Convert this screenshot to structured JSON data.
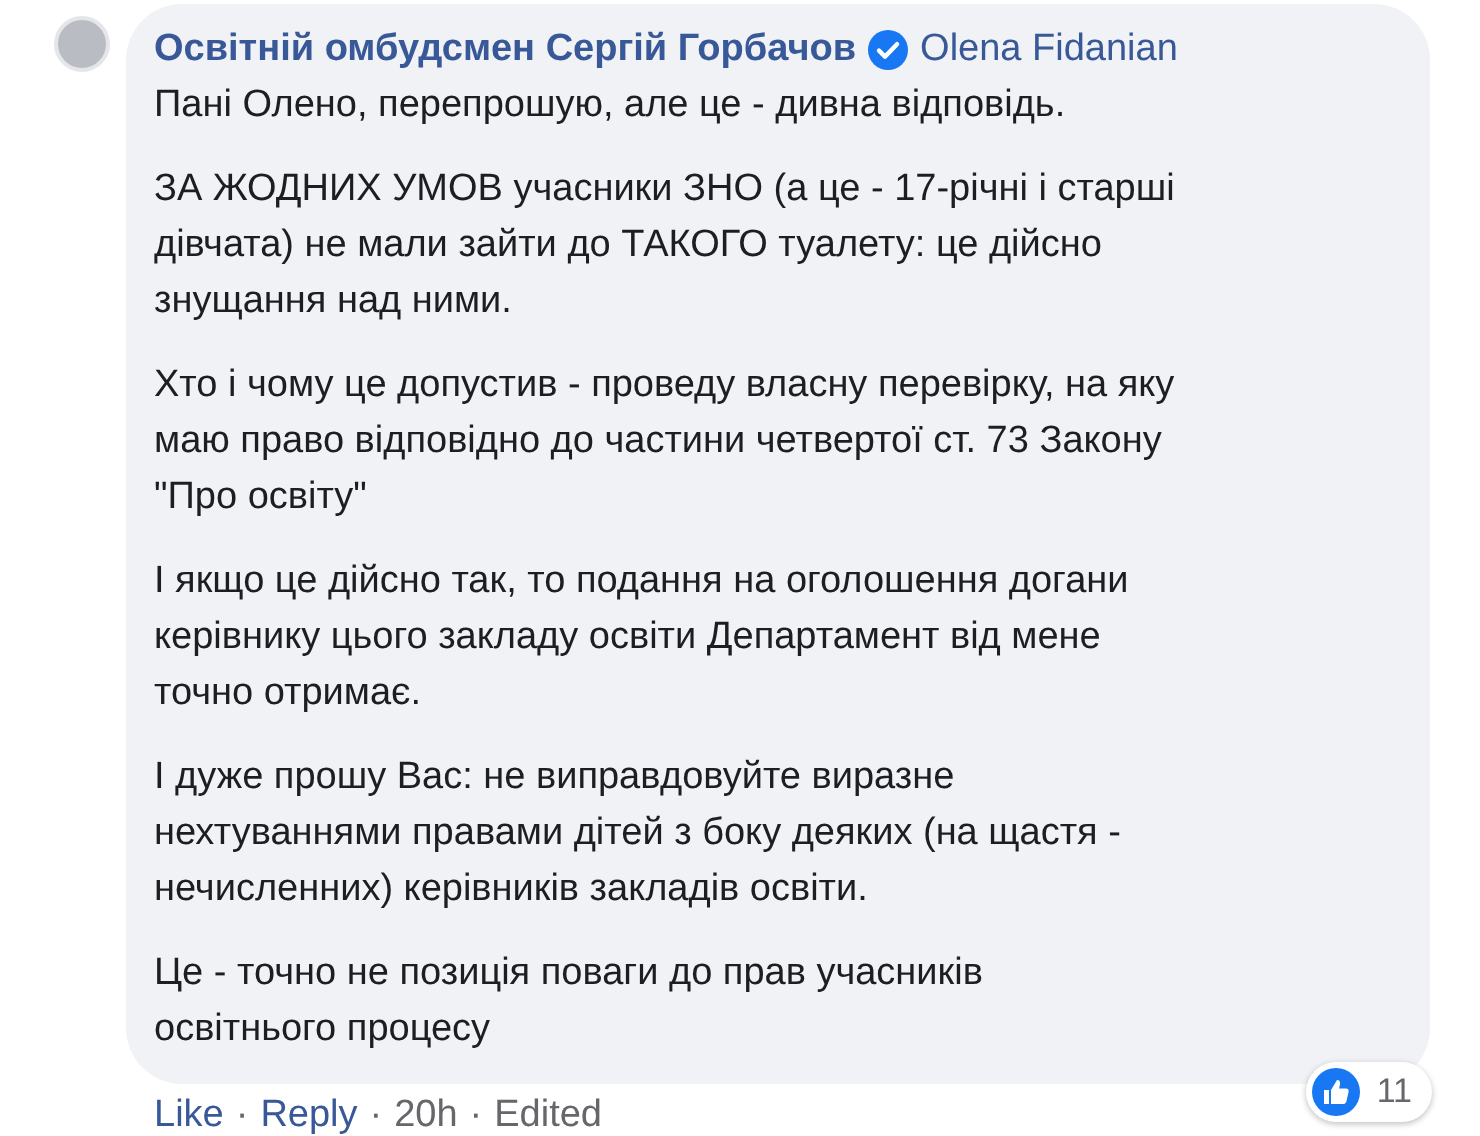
{
  "comment": {
    "author": "Освітній омбудсмен Сергій Горбачов",
    "verified": true,
    "tagged": "Olena Fidanian",
    "paragraphs": [
      "Пані Олено, перепрошую, але це - дивна відповідь.",
      "ЗА ЖОДНИХ УМОВ учасники ЗНО (а це - 17-річні і старші\nдівчата) не мали зайти до ТАКОГО туалету: це дійсно\nзнущання над ними.",
      "Хто і чому це допустив - проведу власну перевірку, на яку\nмаю право відповідно до частини четвертої ст. 73 Закону\n\"Про освіту\"",
      "І якщо це дійсно так, то подання на оголошення догани\nкерівнику цього закладу освіти Департамент від мене\nточно отримає.",
      "І дуже прошу Вас: не виправдовуйте виразне\nнехтуваннями правами дітей з боку деяких (на щастя -\nнечисленних) керівників закладів освіти.",
      "Це - точно не позиція поваги до прав учасників\nосвітнього процесу"
    ],
    "reactions": {
      "count": "11"
    },
    "actions": [
      {
        "label": "Like",
        "kind": "link"
      },
      {
        "label": "Reply",
        "kind": "link"
      },
      {
        "label": "20h",
        "kind": "text"
      },
      {
        "label": "Edited",
        "kind": "text"
      }
    ],
    "separator": "·"
  }
}
